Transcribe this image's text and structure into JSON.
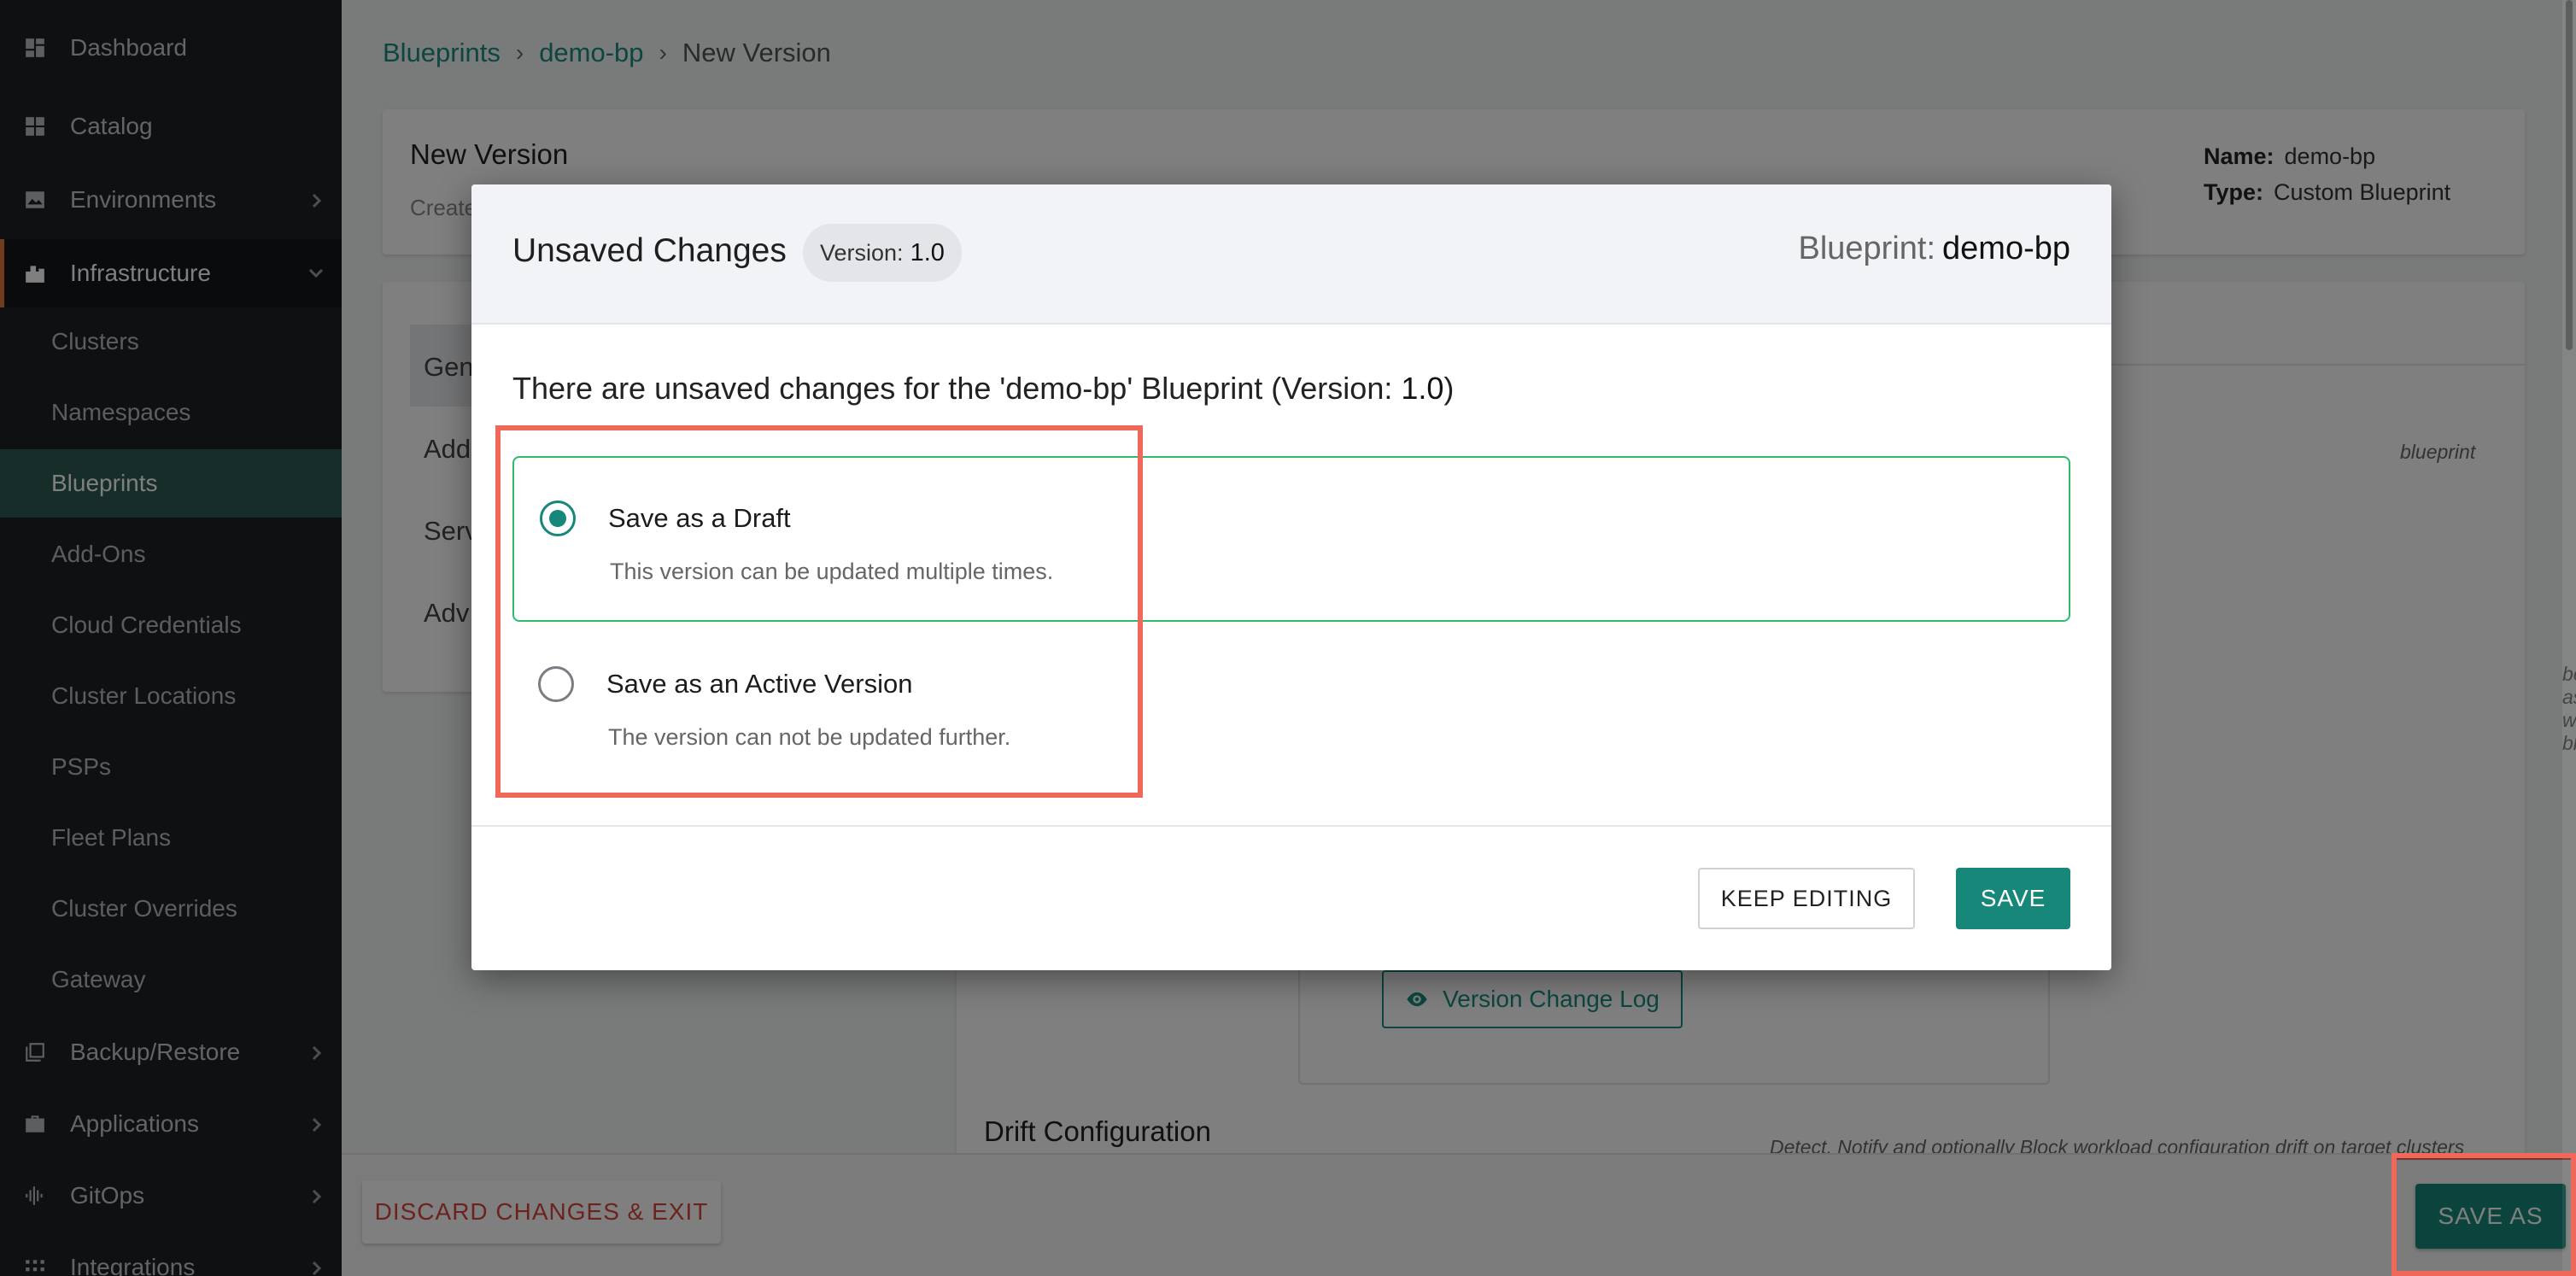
{
  "sidebar": {
    "top_items": [
      {
        "label": "Dashboard",
        "icon": "dashboard-icon"
      },
      {
        "label": "Catalog",
        "icon": "catalog-icon"
      },
      {
        "label": "Environments",
        "icon": "environments-icon"
      },
      {
        "label": "Infrastructure",
        "icon": "infrastructure-icon"
      }
    ],
    "sub_items": [
      "Clusters",
      "Namespaces",
      "Blueprints",
      "Add-Ons",
      "Cloud Credentials",
      "Cluster Locations",
      "PSPs",
      "Fleet Plans",
      "Cluster Overrides",
      "Gateway"
    ],
    "bottom_items": [
      {
        "label": "Backup/Restore",
        "icon": "backup-icon"
      },
      {
        "label": "Applications",
        "icon": "briefcase-icon"
      },
      {
        "label": "GitOps",
        "icon": "gitops-icon"
      },
      {
        "label": "Integrations",
        "icon": "integrations-icon"
      }
    ]
  },
  "breadcrumb": {
    "items": [
      "Blueprints",
      "demo-bp",
      "New Version"
    ],
    "separator": "›"
  },
  "page": {
    "title": "New Version",
    "subtitle": "Create",
    "name_label": "Name:",
    "name_value": "demo-bp",
    "type_label": "Type:",
    "type_value": "Custom Blueprint",
    "tabs": [
      "Gen",
      "Add",
      "Serv",
      "Adv"
    ],
    "hint_1": "blueprint",
    "hint_2": "be associated with the blueprint",
    "version_change_log": "Version Change Log",
    "drift_title": "Drift Configuration",
    "drift_hint": "Detect, Notify and optionally Block workload configuration drift on target clusters"
  },
  "footer": {
    "discard_label": "DISCARD CHANGES & EXIT",
    "save_as_label": "SAVE AS"
  },
  "modal": {
    "title": "Unsaved Changes",
    "version_label": "Version:",
    "version_value": "1.0",
    "blueprint_label": "Blueprint:",
    "blueprint_value": "demo-bp",
    "message_prefix": "There are unsaved changes for the 'demo-bp' Blueprint (Version: ",
    "message_version": "1.0",
    "message_suffix": ")",
    "options": [
      {
        "label": "Save as a Draft",
        "description": "This version can be updated multiple times.",
        "selected": true
      },
      {
        "label": "Save as an Active Version",
        "description": "The version can not be updated further.",
        "selected": false
      }
    ],
    "keep_editing_label": "KEEP EDITING",
    "save_label": "SAVE"
  },
  "colors": {
    "accent": "#17877a",
    "highlight": "#f0685a",
    "selected_border": "#2ebc6b",
    "danger": "#d8443a"
  }
}
